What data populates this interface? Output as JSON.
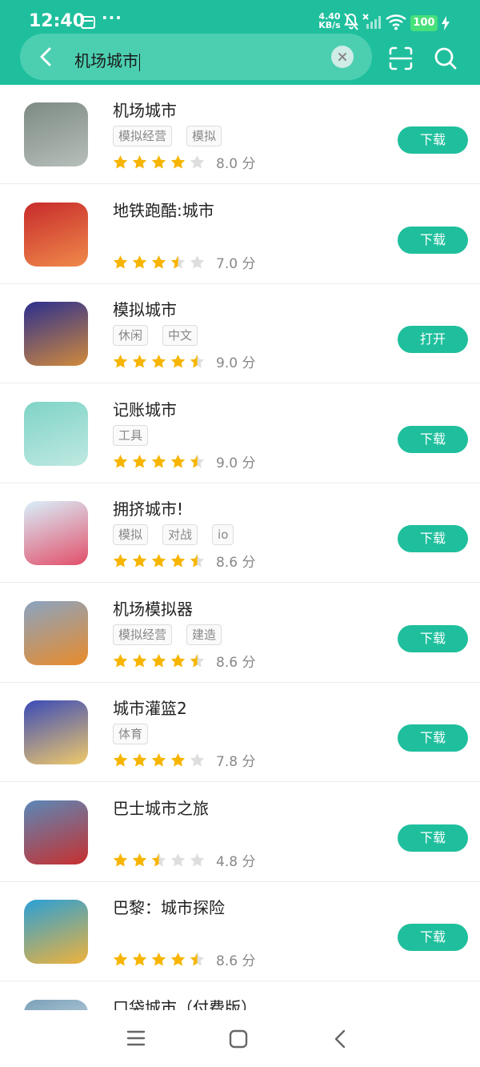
{
  "status_bar": {
    "time": "12:40",
    "more": "···",
    "speed_value": "4.40",
    "speed_unit": "KB/s",
    "battery": "100"
  },
  "search": {
    "query": "机场城市",
    "clear_icon": "×"
  },
  "apps": [
    {
      "name": "机场城市",
      "tags": [
        "模拟经营",
        "模拟"
      ],
      "stars": 4,
      "score": "8.0 分",
      "action": "下载",
      "icon_colors": [
        "#7d8a83",
        "#b7bfbb"
      ]
    },
    {
      "name": "地铁跑酷:城市",
      "tags": [],
      "stars": 3.5,
      "score": "7.0 分",
      "action": "下载",
      "icon_colors": [
        "#c72b2b",
        "#f08a4b"
      ]
    },
    {
      "name": "模拟城市",
      "tags": [
        "休闲",
        "中文"
      ],
      "stars": 4.5,
      "score": "9.0 分",
      "action": "打开",
      "icon_colors": [
        "#2b2f8f",
        "#d18a3c"
      ]
    },
    {
      "name": "记账城市",
      "tags": [
        "工具"
      ],
      "stars": 4.5,
      "score": "9.0 分",
      "action": "下载",
      "icon_colors": [
        "#7fd3c6",
        "#bfe9e1"
      ]
    },
    {
      "name": "拥挤城市!",
      "tags": [
        "模拟",
        "对战",
        "io"
      ],
      "stars": 4.5,
      "score": "8.6 分",
      "action": "下载",
      "icon_colors": [
        "#d9f0fb",
        "#e24f6a"
      ]
    },
    {
      "name": "机场模拟器",
      "tags": [
        "模拟经营",
        "建造"
      ],
      "stars": 4.5,
      "score": "8.6 分",
      "action": "下载",
      "icon_colors": [
        "#8aa4c2",
        "#e98b2a"
      ]
    },
    {
      "name": "城市灌篮2",
      "tags": [
        "体育"
      ],
      "stars": 4,
      "score": "7.8 分",
      "action": "下载",
      "icon_colors": [
        "#3a4bb8",
        "#f0c96a"
      ]
    },
    {
      "name": "巴士城市之旅",
      "tags": [],
      "stars": 2.5,
      "score": "4.8 分",
      "action": "下载",
      "icon_colors": [
        "#5a88b8",
        "#c7302f"
      ]
    },
    {
      "name": "巴黎：城市探险",
      "tags": [],
      "stars": 4.5,
      "score": "8.6 分",
      "action": "下载",
      "icon_colors": [
        "#2aa0d6",
        "#f0b23b"
      ]
    },
    {
      "name": "口袋城市（付费版）",
      "tags": [],
      "stars": 0,
      "score": "",
      "action": "",
      "icon_colors": [
        "#7aa0b8",
        "#e3ecf2"
      ]
    }
  ],
  "colors": {
    "accent": "#1fbf9d",
    "star_on": "#f7b500",
    "star_off": "#dedede"
  }
}
